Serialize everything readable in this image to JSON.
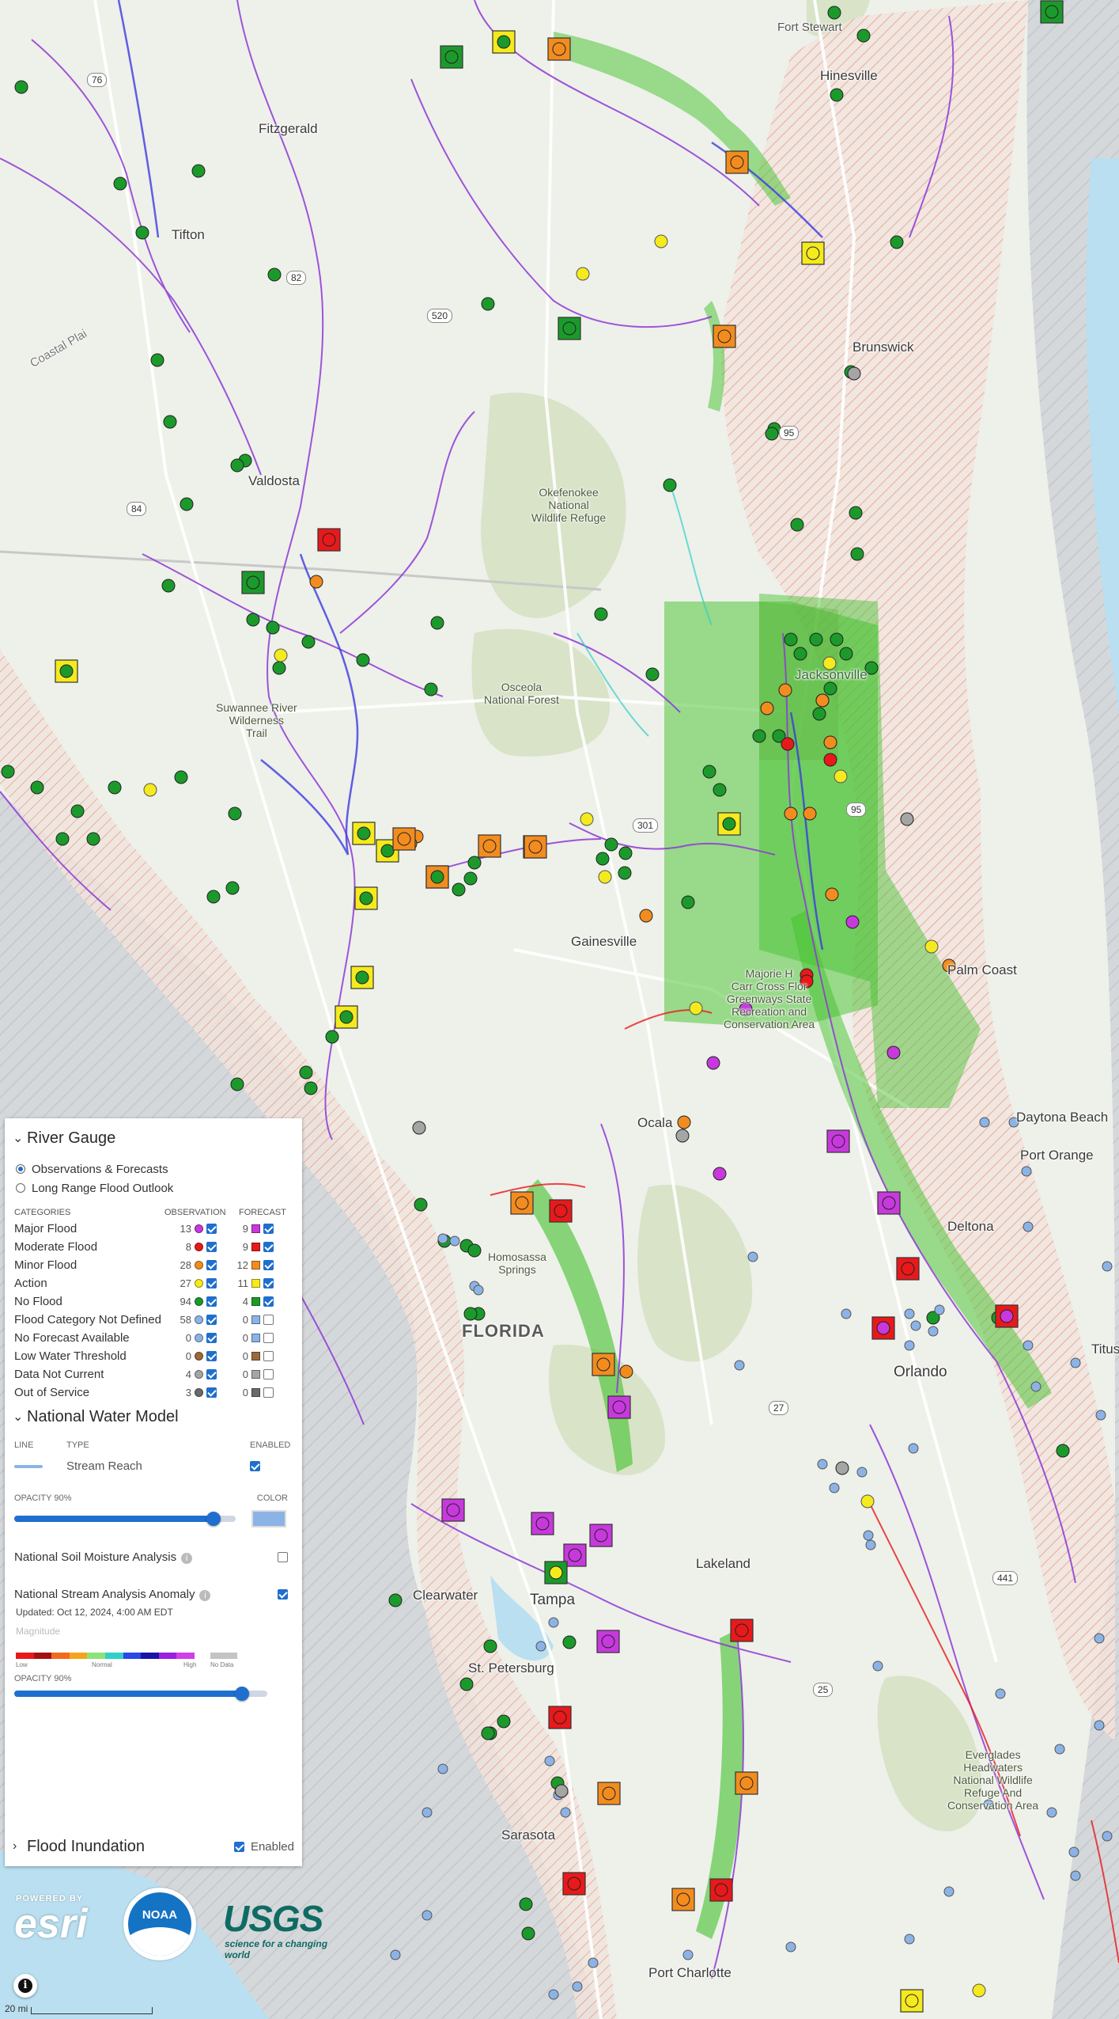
{
  "map": {
    "colors": {
      "land": "#eef0ea",
      "water": "#b9dff0",
      "forest": "#d8e3c8",
      "hatch": "#e7a08b",
      "major": "#c739dd",
      "moderate": "#e8191b",
      "minor": "#f28c1f",
      "action": "#f5ea1d",
      "no_flood": "#1b9a2b",
      "not_defined": "#8cb3e5",
      "not_current": "#a5a5a5",
      "out_of_service": "#6a6a6a",
      "inundation": "#41c22a"
    },
    "place_labels": [
      {
        "name": "Fort Stewart",
        "style": "small"
      },
      {
        "name": "Hinesville",
        "style": "normal"
      },
      {
        "name": "Fitzgerald",
        "style": "normal"
      },
      {
        "name": "Tifton",
        "style": "normal"
      },
      {
        "name": "Brunswick",
        "style": "normal"
      },
      {
        "name": "Valdosta",
        "style": "normal"
      },
      {
        "name": "Okefenokee\nNational\nWildlife Refuge",
        "style": "center"
      },
      {
        "name": "Osceola\nNational Forest",
        "style": "center"
      },
      {
        "name": "Suwannee River\nWilderness\nTrail",
        "style": "center"
      },
      {
        "name": "Jacksonville",
        "style": "normal"
      },
      {
        "name": "Gainesville",
        "style": "normal"
      },
      {
        "name": "Majorie H\nCarr Cross Flor\nGreenways State\nRecreation and\nConservation Area",
        "style": "center"
      },
      {
        "name": "Palm Coast",
        "style": "normal"
      },
      {
        "name": "Ocala",
        "style": "normal"
      },
      {
        "name": "Daytona Beach",
        "style": "normal"
      },
      {
        "name": "Port Orange",
        "style": "normal"
      },
      {
        "name": "Homosassa\nSprings",
        "style": "center"
      },
      {
        "name": "Deltona",
        "style": "normal"
      },
      {
        "name": "FLORIDA",
        "style": "big"
      },
      {
        "name": "Orlando",
        "style": "normal"
      },
      {
        "name": "Titusv",
        "style": "normal"
      },
      {
        "name": "Lakeland",
        "style": "normal"
      },
      {
        "name": "Clearwater",
        "style": "normal"
      },
      {
        "name": "Tampa",
        "style": "normal"
      },
      {
        "name": "St. Petersburg",
        "style": "normal"
      },
      {
        "name": "Everglades\nHeadwaters\nNational Wildlife\nRefuge And\nConservation Area",
        "style": "center"
      },
      {
        "name": "Sarasota",
        "style": "normal"
      },
      {
        "name": "Port Charlotte",
        "style": "normal"
      },
      {
        "name": "Coastal Plai",
        "style": "small"
      }
    ],
    "route_shields": [
      "76",
      "82",
      "520",
      "84",
      "95",
      "301",
      "95",
      "27",
      "441",
      "25"
    ]
  },
  "river_gauge": {
    "title": "River Gauge",
    "modes": [
      {
        "label": "Observations & Forecasts",
        "selected": true
      },
      {
        "label": "Long Range Flood Outlook",
        "selected": false
      }
    ],
    "col_categories": "CATEGORIES",
    "col_observation": "OBSERVATION",
    "col_forecast": "FORECAST",
    "rows": [
      {
        "label": "Major Flood",
        "obs": "13",
        "fc": "9",
        "color": "#c739dd",
        "obs_on": true,
        "fc_on": true
      },
      {
        "label": "Moderate Flood",
        "obs": "8",
        "fc": "9",
        "color": "#e8191b",
        "obs_on": true,
        "fc_on": true
      },
      {
        "label": "Minor Flood",
        "obs": "28",
        "fc": "12",
        "color": "#f28c1f",
        "obs_on": true,
        "fc_on": true
      },
      {
        "label": "Action",
        "obs": "27",
        "fc": "11",
        "color": "#f5ea1d",
        "obs_on": true,
        "fc_on": true
      },
      {
        "label": "No Flood",
        "obs": "94",
        "fc": "4",
        "color": "#1b9a2b",
        "obs_on": true,
        "fc_on": true
      },
      {
        "label": "Flood Category Not Defined",
        "obs": "58",
        "fc": "0",
        "color": "#8cb3e5",
        "obs_on": true,
        "fc_on": false
      },
      {
        "label": "No Forecast Available",
        "obs": "0",
        "fc": "0",
        "color": "#8cb3e5",
        "obs_on": true,
        "fc_on": false
      },
      {
        "label": "Low Water Threshold",
        "obs": "0",
        "fc": "0",
        "color": "#9a6a3c",
        "obs_on": true,
        "fc_on": false
      },
      {
        "label": "Data Not Current",
        "obs": "4",
        "fc": "0",
        "color": "#a5a5a5",
        "obs_on": true,
        "fc_on": false
      },
      {
        "label": "Out of Service",
        "obs": "3",
        "fc": "0",
        "color": "#6a6a6a",
        "obs_on": true,
        "fc_on": false
      }
    ]
  },
  "nwm": {
    "title": "National Water Model",
    "col_line": "LINE",
    "col_type": "TYPE",
    "col_enabled": "ENABLED",
    "stream_label": "Stream Reach",
    "opacity_label": "OPACITY 90%",
    "opacity": 0.9,
    "color_label": "COLOR",
    "swatch_color": "#8cb3e5"
  },
  "soil": {
    "label": "National Soil Moisture Analysis",
    "enabled": false
  },
  "stream_anomaly": {
    "label": "National Stream Analysis Anomaly",
    "enabled": true,
    "updated": "Updated: Oct 12, 2024, 4:00 AM EDT",
    "magnitude": "Magnitude",
    "low": "Low",
    "normal": "Normal",
    "high": "High",
    "no_data": "No Data",
    "opacity_label": "OPACITY 90%",
    "opacity": 0.9,
    "ramp": [
      "#e8191b",
      "#a31212",
      "#f26a1e",
      "#f5a51d",
      "#8fe27a",
      "#30d0c8",
      "#2a49e6",
      "#1a13a8",
      "#9a1fe0",
      "#d13fe8"
    ]
  },
  "inundation": {
    "title": "Flood Inundation",
    "enabled_label": "Enabled",
    "enabled": true
  },
  "logos": {
    "esri_powered": "POWERED BY",
    "esri": "esri",
    "usgs": "USGS",
    "usgs_tagline": "science for a changing world",
    "noaa": "NOAA"
  },
  "info_icon": "i",
  "scale": {
    "label": "20 mi"
  }
}
